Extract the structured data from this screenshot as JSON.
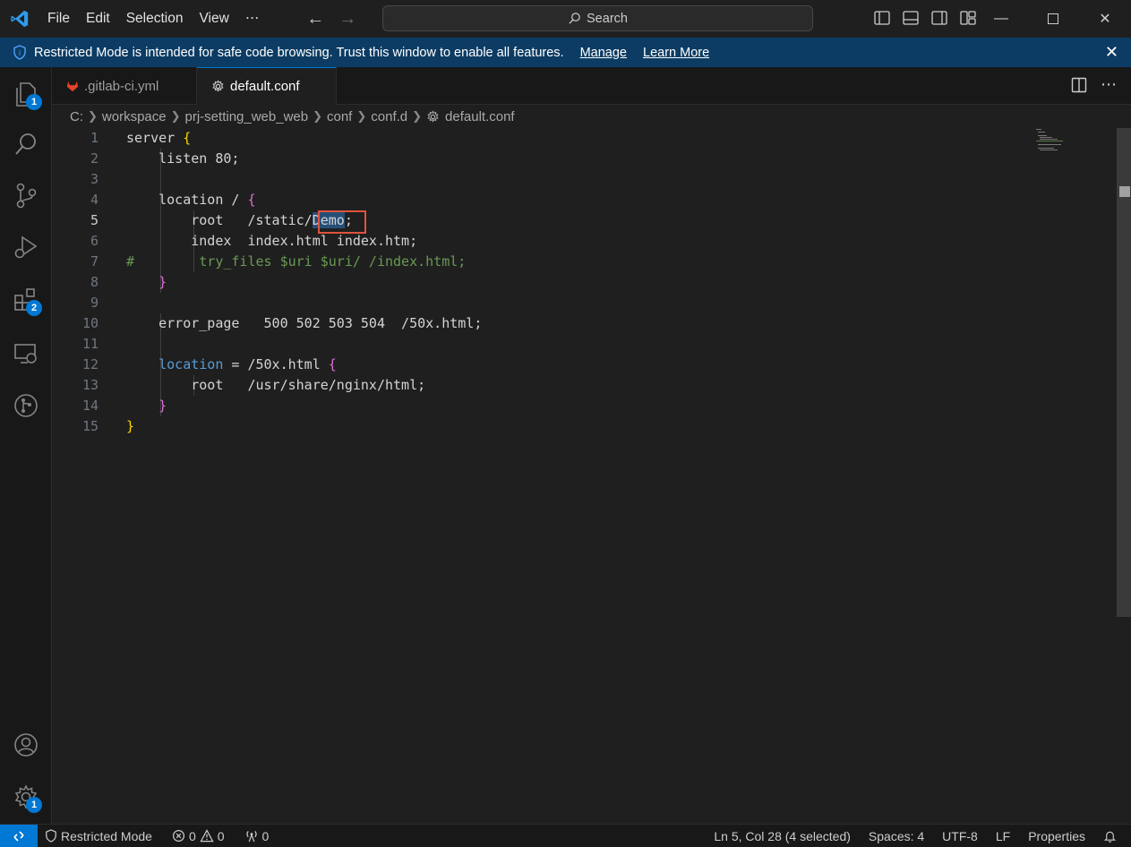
{
  "menu": [
    "File",
    "Edit",
    "Selection",
    "View",
    "⋯"
  ],
  "search": {
    "label": "Search"
  },
  "banner": {
    "message": "Restricted Mode is intended for safe code browsing. Trust this window to enable all features.",
    "manage": "Manage",
    "learn_more": "Learn More"
  },
  "activity_badges": {
    "explorer": "1",
    "extensions": "2",
    "settings": "1"
  },
  "tabs": [
    {
      "label": ".gitlab-ci.yml",
      "icon": "gitlab-icon",
      "active": false
    },
    {
      "label": "default.conf",
      "icon": "gear-icon",
      "active": true,
      "dirty": true
    }
  ],
  "breadcrumb": [
    "C:",
    "workspace",
    "prj-setting_web_web",
    "conf",
    "conf.d",
    "default.conf"
  ],
  "editor": {
    "current_line": 5,
    "selected_text": "Demo",
    "lines": [
      {
        "n": "1",
        "parts": [
          [
            "txt",
            "server "
          ],
          [
            "b1",
            "{"
          ]
        ]
      },
      {
        "n": "2",
        "parts": [
          [
            "txt",
            "    listen 80"
          ],
          [
            "p",
            ";"
          ]
        ]
      },
      {
        "n": "3",
        "parts": []
      },
      {
        "n": "4",
        "parts": [
          [
            "txt",
            "    location / "
          ],
          [
            "b2",
            "{"
          ]
        ]
      },
      {
        "n": "5",
        "parts": [
          [
            "txt",
            "        root   /static/"
          ],
          [
            "sel",
            "Demo"
          ],
          [
            "p",
            ";"
          ]
        ]
      },
      {
        "n": "6",
        "parts": [
          [
            "txt",
            "        index  index.html index.htm"
          ],
          [
            "p",
            ";"
          ]
        ]
      },
      {
        "n": "7",
        "parts": [
          [
            "c",
            "#        try_files $uri $uri/ /index.html;"
          ]
        ]
      },
      {
        "n": "8",
        "parts": [
          [
            "b2",
            "    }"
          ]
        ]
      },
      {
        "n": "9",
        "parts": []
      },
      {
        "n": "10",
        "parts": [
          [
            "txt",
            "    error_page   500 502 503 504  /50x.html"
          ],
          [
            "p",
            ";"
          ]
        ]
      },
      {
        "n": "11",
        "parts": []
      },
      {
        "n": "12",
        "parts": [
          [
            "kw",
            "    location"
          ],
          [
            "txt",
            " = /50x.html "
          ],
          [
            "b2",
            "{"
          ]
        ]
      },
      {
        "n": "13",
        "parts": [
          [
            "txt",
            "        root   /usr/share/nginx/html"
          ],
          [
            "p",
            ";"
          ]
        ]
      },
      {
        "n": "14",
        "parts": [
          [
            "b2",
            "    }"
          ]
        ]
      },
      {
        "n": "15",
        "parts": [
          [
            "b1",
            "}"
          ]
        ]
      }
    ]
  },
  "status": {
    "restricted": "Restricted Mode",
    "errors": "0",
    "warnings": "0",
    "ports": "0",
    "position": "Ln 5, Col 28 (4 selected)",
    "spaces": "Spaces: 4",
    "encoding": "UTF-8",
    "eol": "LF",
    "language": "Properties"
  },
  "colors": {
    "accent": "#0078d4",
    "banner": "#0c3c63",
    "highlight_box": "#e0533e"
  }
}
